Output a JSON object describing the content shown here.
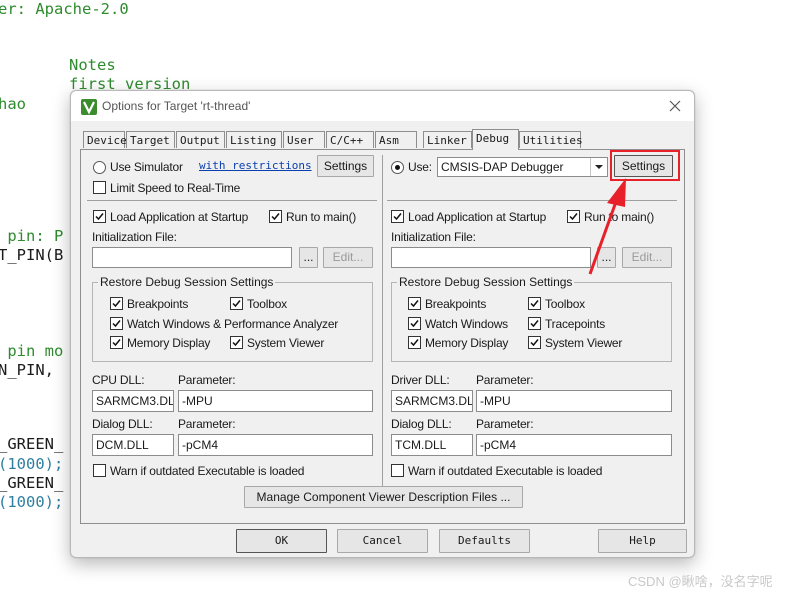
{
  "editor": {
    "lines": [
      {
        "text": "er: Apache-2.0",
        "color": "#2e8b2e"
      },
      {
        "text": "Notes",
        "color": "#2e8b2e"
      },
      {
        "text": "first version",
        "color": "#2e8b2e"
      },
      {
        "text": "hao",
        "color": "#2e8b2e"
      },
      {
        "text": " pin: P",
        "color": "#2e8b2e"
      },
      {
        "text": "T_PIN(B",
        "color": "#1b1b1b"
      },
      {
        "text": " pin mo",
        "color": "#2e8b2e"
      },
      {
        "text": "N_PIN,",
        "color": "#1b1b1b"
      },
      {
        "text": "_GREEN_",
        "color": "#1b1b1b"
      },
      {
        "text": "(1000);",
        "color": "#1b1b1b"
      },
      {
        "text": "_GREEN_",
        "color": "#1b1b1b"
      },
      {
        "text": "(1000);",
        "color": "#1b1b1b"
      }
    ]
  },
  "dialog": {
    "title": "Options for Target 'rt-thread'",
    "icon": "keil-uvision-icon",
    "tabs": [
      "Device",
      "Target",
      "Output",
      "Listing",
      "User",
      "C/C++",
      "Asm",
      "Linker",
      "Debug",
      "Utilities"
    ],
    "active_tab": "Debug",
    "left": {
      "use_simulator": {
        "label": "Use Simulator",
        "selected": false
      },
      "restrictions_link": "with restrictions",
      "settings_label": "Settings",
      "limit_speed": {
        "label": "Limit Speed to Real-Time",
        "checked": false
      },
      "load_app": {
        "label": "Load Application at Startup",
        "checked": true
      },
      "run_to_main": {
        "label": "Run to main()",
        "checked": true
      },
      "init_file_label": "Initialization File:",
      "init_file_value": "",
      "browse_label": "...",
      "edit_label": "Edit...",
      "restore_group": {
        "title": "Restore Debug Session Settings",
        "breakpoints": {
          "label": "Breakpoints",
          "checked": true
        },
        "toolbox": {
          "label": "Toolbox",
          "checked": true
        },
        "watch": {
          "label": "Watch Windows & Performance Analyzer",
          "checked": true
        },
        "memory": {
          "label": "Memory Display",
          "checked": true
        },
        "system_viewer": {
          "label": "System Viewer",
          "checked": true
        }
      },
      "dll": {
        "cpu_dll_label": "CPU DLL:",
        "parameter_label": "Parameter:",
        "cpu_dll": "SARMCM3.DLL",
        "cpu_param": "-MPU",
        "dialog_dll_label": "Dialog DLL:",
        "dialog_dll": "DCM.DLL",
        "dialog_param": "-pCM4"
      },
      "warn": {
        "label": "Warn if outdated Executable is loaded",
        "checked": false
      }
    },
    "right": {
      "use": {
        "label": "Use:",
        "selected": true
      },
      "debugger": "CMSIS-DAP Debugger",
      "settings_label": "Settings",
      "load_app": {
        "label": "Load Application at Startup",
        "checked": true
      },
      "run_to_main": {
        "label": "Run to main()",
        "checked": true
      },
      "init_file_label": "Initialization File:",
      "init_file_value": "",
      "browse_label": "...",
      "edit_label": "Edit...",
      "restore_group": {
        "title": "Restore Debug Session Settings",
        "breakpoints": {
          "label": "Breakpoints",
          "checked": true
        },
        "toolbox": {
          "label": "Toolbox",
          "checked": true
        },
        "watch": {
          "label": "Watch Windows",
          "checked": true
        },
        "tracepoints": {
          "label": "Tracepoints",
          "checked": true
        },
        "memory": {
          "label": "Memory Display",
          "checked": true
        },
        "system_viewer": {
          "label": "System Viewer",
          "checked": true
        }
      },
      "dll": {
        "driver_dll_label": "Driver DLL:",
        "parameter_label": "Parameter:",
        "driver_dll": "SARMCM3.DLL",
        "driver_param": "-MPU",
        "dialog_dll_label": "Dialog DLL:",
        "dialog_dll": "TCM.DLL",
        "dialog_param": "-pCM4"
      },
      "warn": {
        "label": "Warn if outdated Executable is loaded",
        "checked": false
      }
    },
    "manage_button": "Manage Component Viewer Description Files ...",
    "footer": {
      "ok": "OK",
      "cancel": "Cancel",
      "defaults": "Defaults",
      "help": "Help"
    }
  },
  "annotation": {
    "color": "#e8202a",
    "target": "right.settings_button"
  },
  "watermark": "CSDN @瞅啥，没名字呢"
}
